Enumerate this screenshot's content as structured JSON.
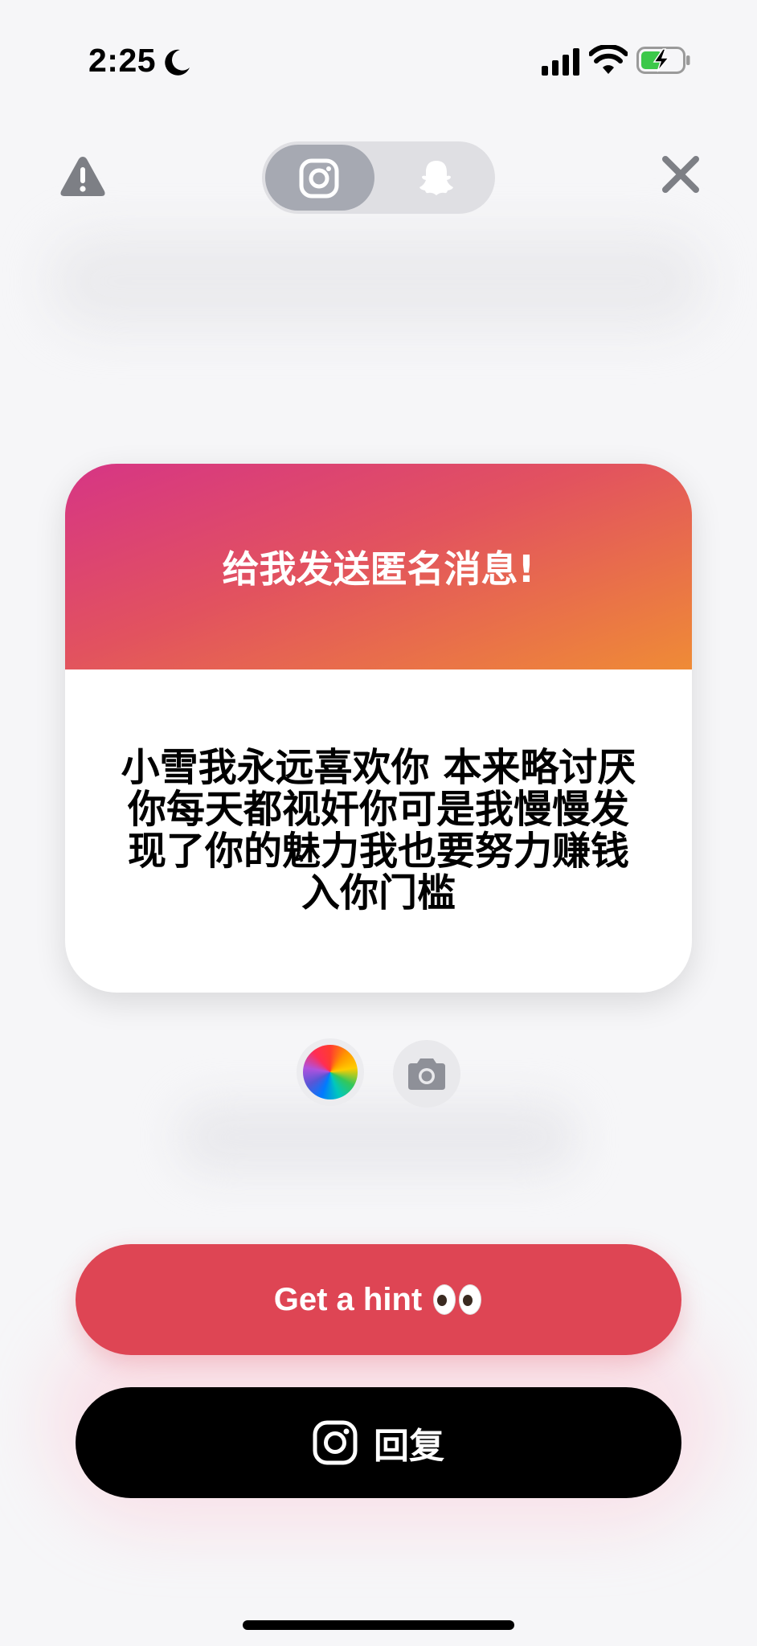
{
  "status_bar": {
    "time": "2:25",
    "icons": [
      "moon-icon",
      "signal-icon",
      "wifi-icon",
      "battery-charging-icon"
    ]
  },
  "header": {
    "left_icon": "warning-icon",
    "right_icon": "close-icon",
    "platform_toggle": {
      "options": [
        "instagram-icon",
        "snapchat-icon"
      ],
      "selected": "instagram"
    }
  },
  "card": {
    "title": "给我发送匿名消息!",
    "message": "小雪我永远喜欢你 本来略讨厌你每天都视奸你可是我慢慢发现了你的魅力我也要努力赚钱入你门槛",
    "gradient_colors": [
      "#d63585",
      "#e2525f",
      "#ef8b36"
    ]
  },
  "style_controls": {
    "color_picker_icon": "color-wheel-icon",
    "camera_icon": "camera-icon"
  },
  "actions": {
    "hint_label": "Get a hint",
    "hint_emoji": "eyes",
    "reply_label": "回复",
    "hint_color": "#de4554",
    "reply_color": "#000000"
  }
}
